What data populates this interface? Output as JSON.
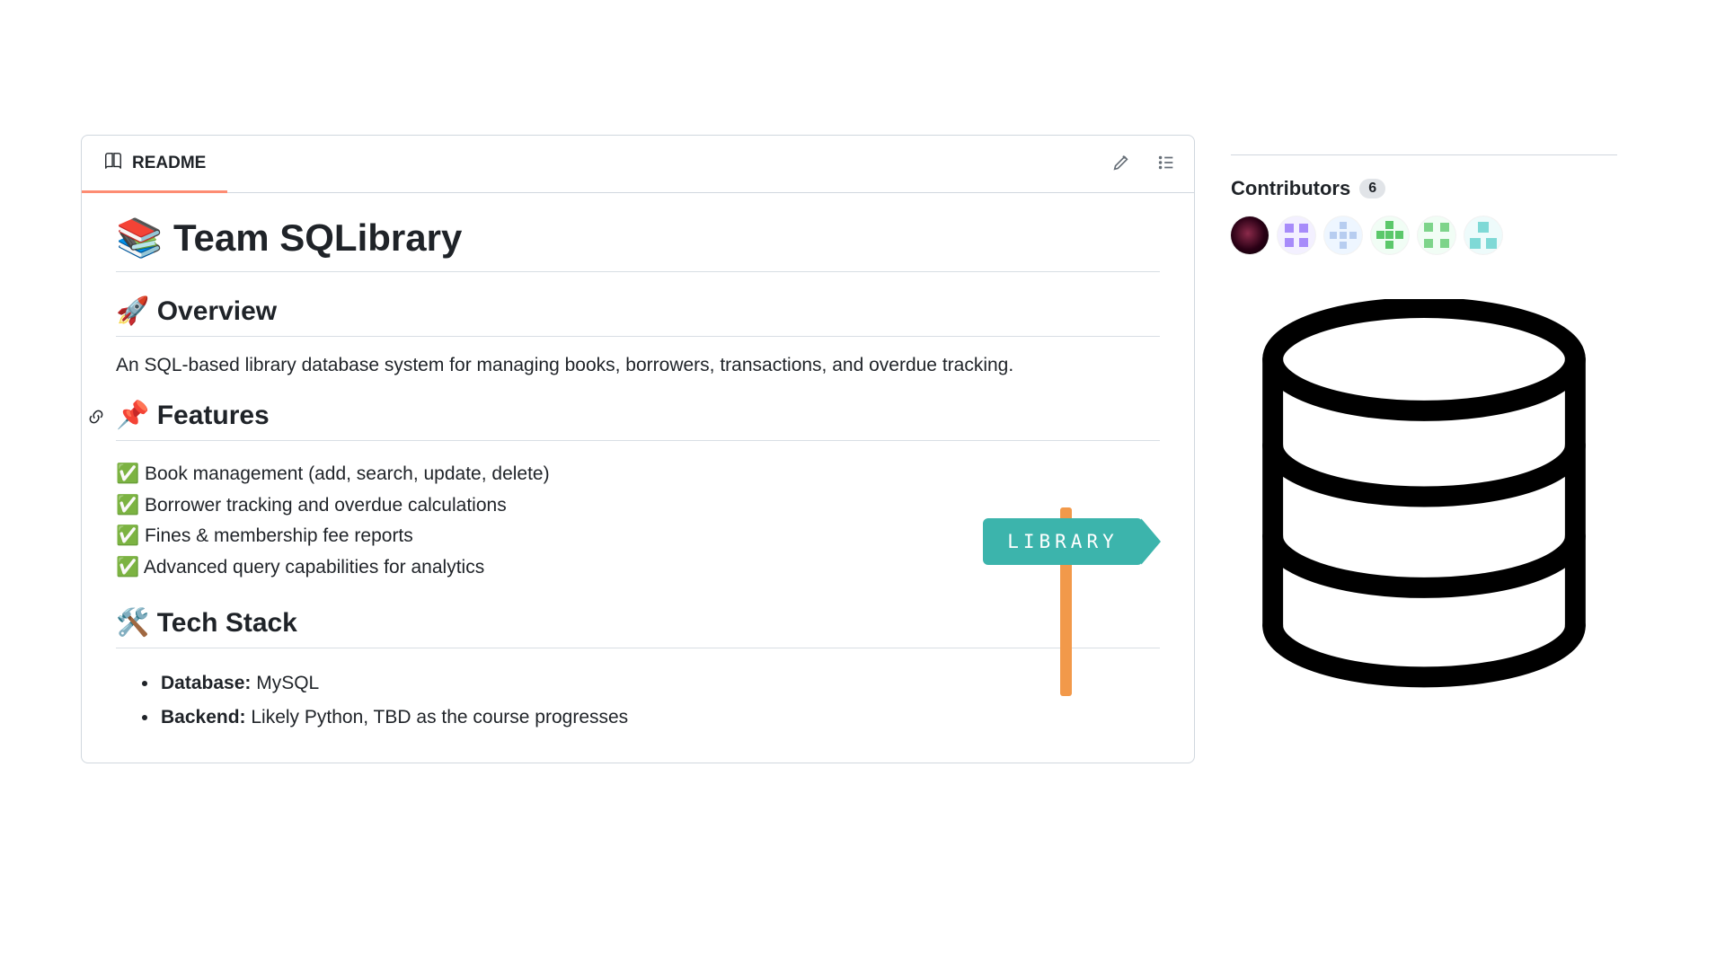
{
  "readme": {
    "tab_label": "README",
    "title": "📚 Team SQLibrary",
    "overview_heading": "🚀 Overview",
    "overview_text": "An SQL-based library database system for managing books, borrowers, transactions, and overdue tracking.",
    "features_heading": "📌 Features",
    "features": [
      "✅ Book management (add, search, update, delete)",
      "✅ Borrower tracking and overdue calculations",
      "✅ Fines & membership fee reports",
      "✅ Advanced query capabilities for analytics"
    ],
    "tech_heading": "🛠️ Tech Stack",
    "tech_stack": [
      {
        "label": "Database:",
        "value": " MySQL"
      },
      {
        "label": "Backend:",
        "value": " Likely Python, TBD as the course progresses"
      }
    ],
    "sign_text": "LIBRARY"
  },
  "sidebar": {
    "contributors_label": "Contributors",
    "contributors_count": "6"
  }
}
